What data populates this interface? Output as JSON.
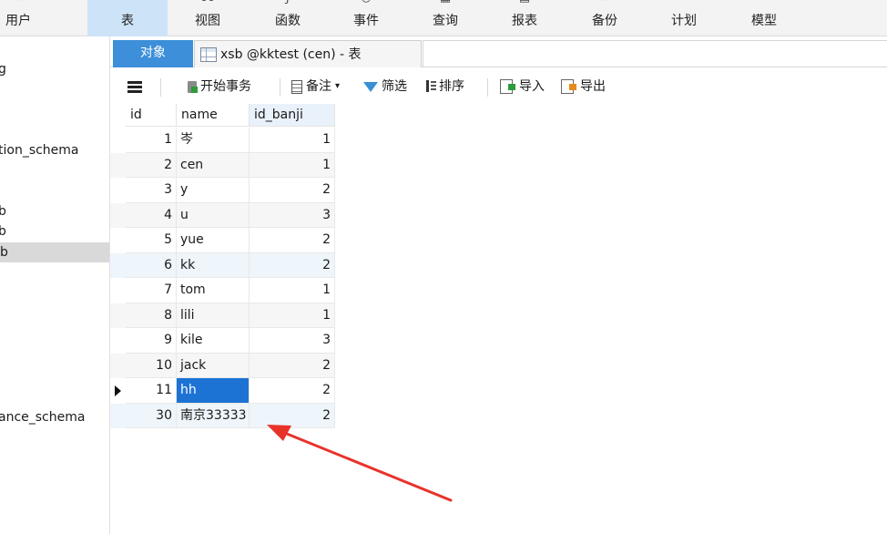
{
  "ribbon": {
    "items": [
      {
        "label": "用户",
        "icon": "user-icon"
      },
      {
        "label": "表",
        "icon": "table-icon",
        "active": true
      },
      {
        "label": "视图",
        "icon": "view-icon"
      },
      {
        "label": "函数",
        "icon": "function-icon"
      },
      {
        "label": "事件",
        "icon": "event-icon"
      },
      {
        "label": "查询",
        "icon": "query-icon"
      },
      {
        "label": "报表",
        "icon": "report-icon"
      },
      {
        "label": "备份",
        "icon": "backup-icon"
      },
      {
        "label": "计划",
        "icon": "schedule-icon"
      },
      {
        "label": "模型",
        "icon": "model-icon"
      }
    ]
  },
  "navigator": {
    "items": [
      {
        "label": "g"
      },
      {
        "label": "tion_schema"
      },
      {
        "label": "b"
      },
      {
        "label": "b"
      },
      {
        "label": "b",
        "selected": true
      },
      {
        "label": "ance_schema"
      }
    ]
  },
  "tabs": {
    "objects_label": "对象",
    "active_tab_label": "xsb @kktest (cen) - 表"
  },
  "grid_toolbar": {
    "begin_transaction": "开始事务",
    "memo": "备注",
    "filter": "筛选",
    "sort": "排序",
    "import": "导入",
    "export": "导出"
  },
  "table": {
    "columns": [
      "id",
      "name",
      "id_banji"
    ],
    "rows": [
      {
        "id": "1",
        "name": "岑",
        "id_banji": "1"
      },
      {
        "id": "2",
        "name": "cen",
        "id_banji": "1"
      },
      {
        "id": "3",
        "name": "y",
        "id_banji": "2"
      },
      {
        "id": "4",
        "name": "u",
        "id_banji": "3"
      },
      {
        "id": "5",
        "name": "yue",
        "id_banji": "2"
      },
      {
        "id": "6",
        "name": "kk",
        "id_banji": "2"
      },
      {
        "id": "7",
        "name": "tom",
        "id_banji": "1"
      },
      {
        "id": "8",
        "name": "lili",
        "id_banji": "1"
      },
      {
        "id": "9",
        "name": "kile",
        "id_banji": "3"
      },
      {
        "id": "10",
        "name": "jack",
        "id_banji": "2"
      },
      {
        "id": "11",
        "name": "hh",
        "id_banji": "2"
      },
      {
        "id": "30",
        "name": "南京33333",
        "id_banji": "2"
      }
    ]
  },
  "colors": {
    "accent": "#3c8fd8",
    "selection": "#1d73d4",
    "annotation_arrow": "#e8332b"
  }
}
